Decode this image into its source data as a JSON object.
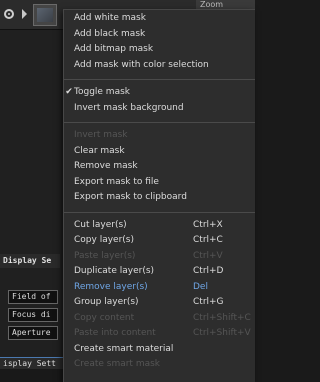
{
  "background": {
    "zoom_label": "Zoom",
    "panel_title": "Display Se",
    "fields": [
      "Field of",
      "Focus di",
      "Aperture"
    ],
    "status_text": "isplay Sett"
  },
  "menu": {
    "groups": [
      [
        {
          "label": "Add white mask"
        },
        {
          "label": "Add black mask"
        },
        {
          "label": "Add bitmap mask"
        },
        {
          "label": "Add mask with color selection"
        }
      ],
      [
        {
          "label": "Toggle mask",
          "checked": true,
          "check_glyph": "✔"
        },
        {
          "label": "Invert mask background"
        }
      ],
      [
        {
          "label": "Invert mask",
          "disabled": true
        },
        {
          "label": "Clear mask"
        },
        {
          "label": "Remove mask"
        },
        {
          "label": "Export mask to file"
        },
        {
          "label": "Export mask to clipboard"
        }
      ],
      [
        {
          "label": "Cut layer(s)",
          "shortcut": "Ctrl+X"
        },
        {
          "label": "Copy layer(s)",
          "shortcut": "Ctrl+C"
        },
        {
          "label": "Paste layer(s)",
          "shortcut": "Ctrl+V",
          "disabled": true
        },
        {
          "label": "Duplicate layer(s)",
          "shortcut": "Ctrl+D"
        },
        {
          "label": "Remove layer(s)",
          "shortcut": "Del",
          "highlight": true
        },
        {
          "label": "Group layer(s)",
          "shortcut": "Ctrl+G"
        },
        {
          "label": "Copy content",
          "shortcut": "Ctrl+Shift+C",
          "disabled": true
        },
        {
          "label": "Paste into content",
          "shortcut": "Ctrl+Shift+V",
          "disabled": true
        },
        {
          "label": "Create smart material"
        },
        {
          "label": "Create smart mask",
          "disabled": true
        }
      ]
    ]
  },
  "colors": {
    "menu_bg": "#2d2d2d",
    "text": "#dcdcdc",
    "disabled_text": "#555555",
    "highlight_text": "#6fa6e6"
  }
}
